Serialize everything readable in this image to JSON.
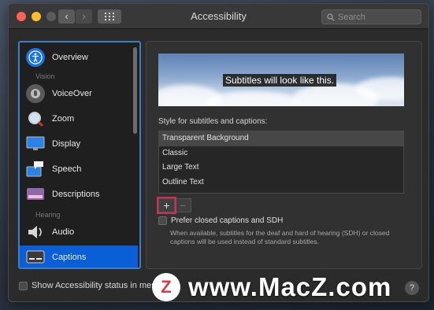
{
  "window": {
    "title": "Accessibility",
    "nav_back": "‹",
    "nav_forward": "›",
    "search_placeholder": "Search"
  },
  "sidebar": {
    "items": [
      {
        "label": "Overview",
        "icon": "accessibility-icon"
      },
      {
        "label": "VoiceOver",
        "icon": "voiceover-icon"
      },
      {
        "label": "Zoom",
        "icon": "zoom-icon"
      },
      {
        "label": "Display",
        "icon": "display-icon"
      },
      {
        "label": "Speech",
        "icon": "speech-icon"
      },
      {
        "label": "Descriptions",
        "icon": "descriptions-icon"
      },
      {
        "label": "Audio",
        "icon": "speaker-icon"
      },
      {
        "label": "Captions",
        "icon": "captions-icon",
        "selected": true
      }
    ],
    "sections": {
      "vision": "Vision",
      "hearing": "Hearing"
    }
  },
  "captions": {
    "preview_text": "Subtitles will look like this.",
    "style_label": "Style for subtitles and captions:",
    "styles": [
      "Transparent Background",
      "Classic",
      "Large Text",
      "Outline Text"
    ],
    "add_label": "+",
    "remove_label": "−",
    "sdh_label": "Prefer closed captions and SDH",
    "sdh_description": "When available, subtitles for the deaf and hard of hearing (SDH) or closed captions will be used instead of standard subtitles."
  },
  "footer": {
    "show_status_label": "Show Accessibility status in menu bar",
    "help_label": "?"
  },
  "watermark": {
    "logo_letter": "Z",
    "text": "www.MacZ.com"
  },
  "colors": {
    "accent": "#0a5fd6",
    "highlight_box": "#d42a5b"
  }
}
